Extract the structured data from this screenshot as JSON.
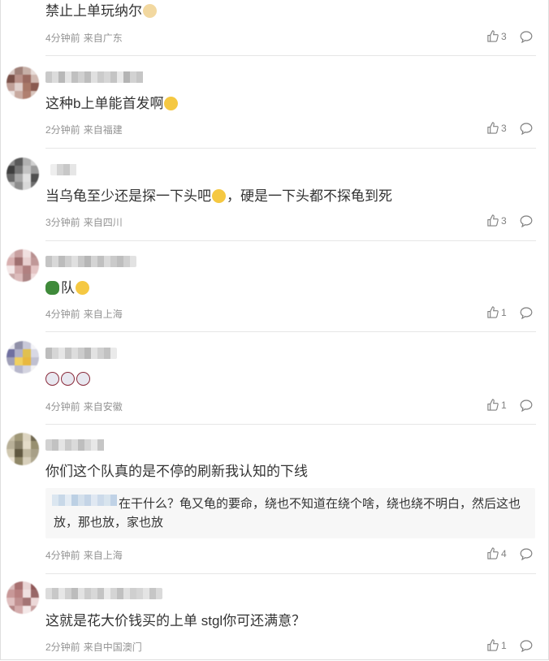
{
  "comments": [
    {
      "text": "禁止上单玩纳尔",
      "emoji": "dog-emoji",
      "time": "4分钟前",
      "source": "来自广东",
      "likes": "3",
      "avatar_colors": [],
      "name_colors": []
    },
    {
      "text": "这种b上单能首发啊",
      "emoji": "laugh-cry-emoji",
      "time": "2分钟前",
      "source": "来自福建",
      "likes": "3",
      "avatar_colors": [
        "#d8c8c4",
        "#a08078",
        "#c7b0a8",
        "#e8dcd8",
        "#7a5048",
        "#b89088",
        "#9a6a60",
        "#d0b8b0",
        "#c0a098",
        "#e0d0cc",
        "#a87868",
        "#8a5a50",
        "#ece4e2",
        "#c8aaa0",
        "#b08070",
        "#d8c4bc"
      ],
      "name_colors": [
        "#c9c9c9",
        "#dcdcdc",
        "#b8b8b8",
        "#e4e4e4",
        "#c0c0c0",
        "#d0d0d0",
        "#bdbdbd",
        "#e0e0e0",
        "#cbcbcb",
        "#d6d6d6",
        "#c4c4c4",
        "#e8e8e8",
        "#b4b4b4",
        "#d2d2d2",
        "#c6c6c6",
        "#dedede"
      ]
    },
    {
      "text": "当乌龟至少还是探一下头吧",
      "text2": "，硬是一下头都不探龟到死",
      "emoji": "crying-emoji",
      "time": "3分钟前",
      "source": "来自四川",
      "likes": "3",
      "avatar_colors": [
        "#8a8a8a",
        "#5a5a5a",
        "#b0b0b0",
        "#d0d0d0",
        "#3e3e3e",
        "#767676",
        "#c2c2c2",
        "#9a9a9a",
        "#686868",
        "#a8a8a8",
        "#e0e0e0",
        "#505050",
        "#bcbcbc",
        "#8e8e8e",
        "#d8d8d8",
        "#6e6e6e"
      ],
      "name_colors": [
        "#eeeeee",
        "#d4d4d4",
        "#c8c8c8",
        "#e6e6e6"
      ]
    },
    {
      "text": "队",
      "emoji_before": "turtle-emoji",
      "emoji": "shy-emoji",
      "time": "4分钟前",
      "source": "来自上海",
      "likes": "1",
      "avatar_colors": [
        "#e0c8c8",
        "#c8a0a0",
        "#f0e0e0",
        "#b89090",
        "#d8b0b0",
        "#a07070",
        "#e8d0d0",
        "#c09898",
        "#f4e8e8",
        "#d0a8a8",
        "#b08080",
        "#e4c4c4",
        "#c8a8a8",
        "#dcbcbc",
        "#ac8484",
        "#f0dcdc"
      ],
      "name_colors": [
        "#c4c4c4",
        "#d8d8d8",
        "#bcbcbc",
        "#cfcfcf",
        "#e0e0e0",
        "#c8c8c8",
        "#b6b6b6",
        "#d4d4d4",
        "#c0c0c0",
        "#dadada",
        "#cacaca",
        "#bebebe",
        "#d0d0d0",
        "#e2e2e2"
      ]
    },
    {
      "text": "",
      "emoji_triple": "clown-emoji",
      "time": "4分钟前",
      "source": "来自安徽",
      "likes": "1",
      "avatar_colors": [
        "#e8e8ee",
        "#9090a8",
        "#c8c8d8",
        "#f4f4f8",
        "#7070a0",
        "#b0b0c8",
        "#e0c050",
        "#d8d8e4",
        "#a0a0b8",
        "#f0d060",
        "#e8b840",
        "#c0c0d0",
        "#ececf2",
        "#b8b8cc",
        "#d4d4e0",
        "#f4f4f4"
      ],
      "name_colors": [
        "#bdbdbd",
        "#d6d6d6",
        "#e6e6e6",
        "#c6c6c6",
        "#dddddd",
        "#cccccc",
        "#b8b8b8",
        "#e2e2e2",
        "#d0d0d0",
        "#c2c2c2",
        "#eaeaea"
      ]
    },
    {
      "text": "你们这个队真的是不停的刷新我认知的下线",
      "time": "4分钟前",
      "source": "来自上海",
      "likes": "4",
      "quote": "在干什么？龟又龟的要命，绕也不知道在绕个啥，绕也绕不明白，然后这也放，那也放，家也放",
      "avatar_colors": [
        "#c8c0a8",
        "#a09878",
        "#dcd4c0",
        "#706850",
        "#b8b098",
        "#888068",
        "#e4dcc8",
        "#989070",
        "#d0c8b0",
        "#605840",
        "#c0b8a0",
        "#a8a088",
        "#ece4d4",
        "#908868",
        "#d8d0bc",
        "#b0a890"
      ],
      "name_colors": [
        "#d2d2d2",
        "#c2c2c2",
        "#e4e4e4",
        "#cacaca",
        "#dadada",
        "#bebebe",
        "#d6d6d6",
        "#e8e8e8",
        "#c6c6c6",
        "#dedede"
      ]
    },
    {
      "text": "这就是花大价钱买的上单 stgl你可还满意？",
      "time": "2分钟前",
      "source": "来自中国澳门",
      "likes": "1",
      "avatar_colors": [
        "#d8b8b8",
        "#a87070",
        "#e8d4d4",
        "#905858",
        "#c89898",
        "#b88080",
        "#f0e0e0",
        "#986868",
        "#e0c0c0",
        "#c09090",
        "#a47474",
        "#ecd8d8",
        "#b48484",
        "#d4acac",
        "#f4e8e8",
        "#c8a0a0"
      ],
      "name_colors": [
        "#dcdcdc",
        "#c8c8c8",
        "#e6e6e6",
        "#d0d0d0",
        "#bcbcbc",
        "#e2e2e2",
        "#cccccc",
        "#d8d8d8",
        "#c4c4c4",
        "#eaeaea",
        "#d4d4d4",
        "#c0c0c0",
        "#e0e0e0",
        "#cfcfcf",
        "#d6d6d6",
        "#e4e4e4",
        "#c6c6c6",
        "#dadada"
      ]
    }
  ],
  "colors": {
    "meta": "#939393",
    "divider": "#e6e6e6",
    "quote_bg": "#f7f7f7"
  }
}
